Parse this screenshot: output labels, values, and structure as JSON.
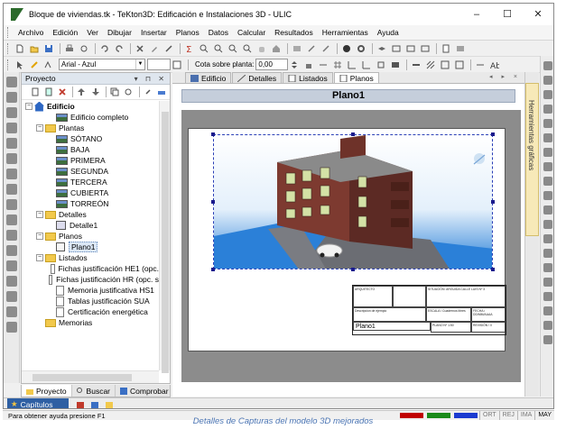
{
  "window": {
    "title": "Bloque de viviendas.tk - TeKton3D: Edificación e Instalaciones 3D - ULIC",
    "controls": [
      "–",
      "☐",
      "✕"
    ]
  },
  "menubar": {
    "items": [
      "Archivo",
      "Edición",
      "Ver",
      "Dibujar",
      "Insertar",
      "Planos",
      "Datos",
      "Calcular",
      "Resultados",
      "Herramientas",
      "Ayuda"
    ]
  },
  "format_toolbar": {
    "font_value": "Arial - Azul",
    "cota_label": "Cota sobre planta:",
    "cota_value": "0,00"
  },
  "project_panel": {
    "title": "Proyecto",
    "header_controls": "▾ ⊓ ✕",
    "tree": [
      {
        "label": "Edificio",
        "level": 0,
        "icon": "house-icon",
        "toggle": "−"
      },
      {
        "label": "Edificio completo",
        "level": 2,
        "icon": "plant-icon"
      },
      {
        "label": "Plantas",
        "level": 1,
        "icon": "folder-icon",
        "toggle": "−"
      },
      {
        "label": "SÓTANO",
        "level": 2,
        "icon": "plant-icon"
      },
      {
        "label": "BAJA",
        "level": 2,
        "icon": "plant-icon"
      },
      {
        "label": "PRIMERA",
        "level": 2,
        "icon": "plant-icon"
      },
      {
        "label": "SEGUNDA",
        "level": 2,
        "icon": "plant-icon"
      },
      {
        "label": "TERCERA",
        "level": 2,
        "icon": "plant-icon"
      },
      {
        "label": "CUBIERTA",
        "level": 2,
        "icon": "plant-icon"
      },
      {
        "label": "TORREÓN",
        "level": 2,
        "icon": "plant-icon"
      },
      {
        "label": "Detalles",
        "level": 1,
        "icon": "folder-icon",
        "toggle": "−"
      },
      {
        "label": "Detalle1",
        "level": 2,
        "icon": "detail-icon"
      },
      {
        "label": "Planos",
        "level": 1,
        "icon": "folder-icon",
        "toggle": "−"
      },
      {
        "label": "Plano1",
        "level": 2,
        "icon": "plano-icon",
        "selected": true
      },
      {
        "label": "Listados",
        "level": 1,
        "icon": "folder-icon",
        "toggle": "−"
      },
      {
        "label": "Fichas justificación HE1 (opc.",
        "level": 2,
        "icon": "doc-icon"
      },
      {
        "label": "Fichas justificación HR (opc. s",
        "level": 2,
        "icon": "doc-icon"
      },
      {
        "label": "Memoria justificativa HS1",
        "level": 2,
        "icon": "doc-icon"
      },
      {
        "label": "Tablas justificación SUA",
        "level": 2,
        "icon": "doc-icon"
      },
      {
        "label": "Certificación energética",
        "level": 2,
        "icon": "doc-icon"
      },
      {
        "label": "Memorias",
        "level": 1,
        "icon": "folder-icon"
      }
    ],
    "bottom_tabs": [
      "Proyecto",
      "Buscar",
      "Comprobar"
    ]
  },
  "capitulos": {
    "label": "Capítulos"
  },
  "document": {
    "tabs": [
      {
        "label": "Edificio",
        "active": false
      },
      {
        "label": "Detalles",
        "active": false
      },
      {
        "label": "Listados",
        "active": false
      },
      {
        "label": "Planos",
        "active": true
      }
    ],
    "nav": "◂ ▸ ×",
    "plano_title": "Plano1",
    "cajetin": {
      "arquitecto": "ARQUITECTO",
      "situacion": "SITUACIÓN: ARGUIDA CALLE LUIS Nº 3",
      "escala": "ESCALA / Cuadernos libres",
      "fecha": "FECHA / DD/MM/AAAA",
      "descripcion": "Descripción de ejemplo",
      "plano_num": "PLANO Nº 1:50",
      "revision": "REVISIÓN / 0",
      "plano_name": "Plano1"
    }
  },
  "right_panel": {
    "title": "Herramientas gráficas"
  },
  "statusbar": {
    "help_text": "Para obtener ayuda presione F1",
    "indicators": [
      "ORT",
      "REJ",
      "IMA",
      "MAY"
    ],
    "colors": [
      "#c00000",
      "#1a8a1a",
      "#1a3bd0"
    ]
  },
  "caption": "Detalles de Capturas del modelo 3D mejorados"
}
